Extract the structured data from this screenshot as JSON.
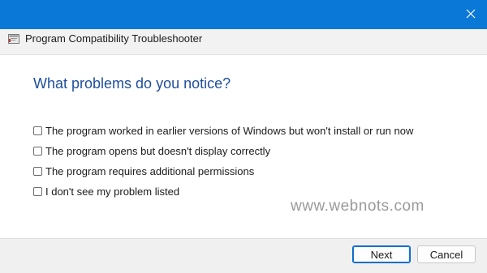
{
  "window": {
    "title": "Program Compatibility Troubleshooter",
    "close_symbol": "✕"
  },
  "main": {
    "heading": "What problems do you notice?",
    "options": [
      {
        "label": "The program worked in earlier versions of Windows but won't install or run now",
        "checked": false
      },
      {
        "label": "The program opens but doesn't display correctly",
        "checked": false
      },
      {
        "label": "The program requires additional permissions",
        "checked": false
      },
      {
        "label": "I don't see my problem listed",
        "checked": false
      }
    ]
  },
  "watermark": "www.webnots.com",
  "footer": {
    "next_label": "Next",
    "cancel_label": "Cancel"
  },
  "colors": {
    "titlebar": "#0a78d6",
    "heading": "#1f4e9c"
  }
}
